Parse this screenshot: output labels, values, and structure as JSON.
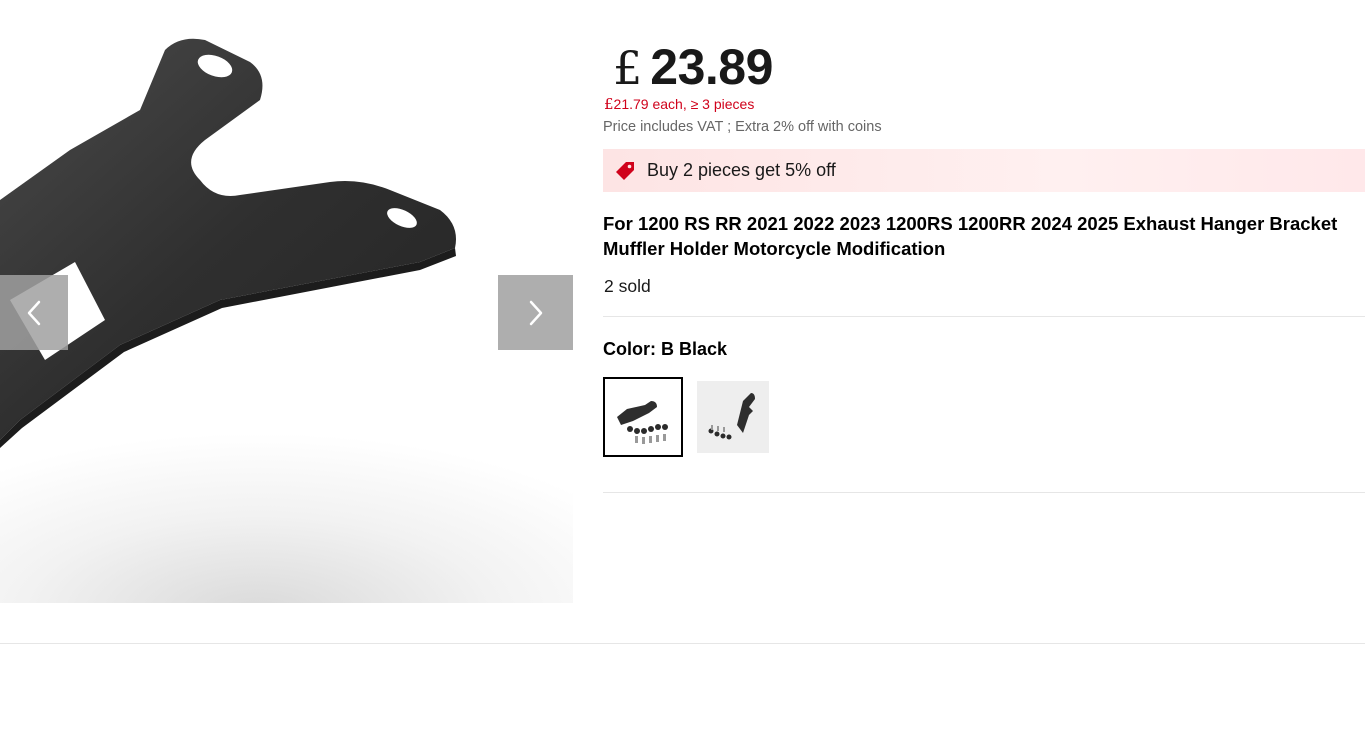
{
  "gallery": {
    "image_icon": "product-bracket-image",
    "prev_icon": "chevron-left-icon",
    "next_icon": "chevron-right-icon"
  },
  "price": {
    "currency_symbol": "£",
    "amount": "23.89",
    "bulk_currency": "£",
    "bulk_text": "21.79 each, ≥ 3 pieces",
    "vat_note": "Price includes VAT ; Extra 2% off with coins"
  },
  "promo": {
    "icon": "tag-icon",
    "text": "Buy 2 pieces get 5% off",
    "color": "#d0021b"
  },
  "product": {
    "title": "For 1200 RS RR 2021 2022 2023 1200RS 1200RR 2024 2025 Exhaust Hanger Bracket Muffler Holder Motorcycle Modification",
    "sold": "2 sold"
  },
  "variants": {
    "color_label": "Color: B Black",
    "options": [
      {
        "icon": "variant-b-black-thumbnail",
        "selected": true
      },
      {
        "icon": "variant-a-thumbnail",
        "selected": false
      }
    ]
  }
}
